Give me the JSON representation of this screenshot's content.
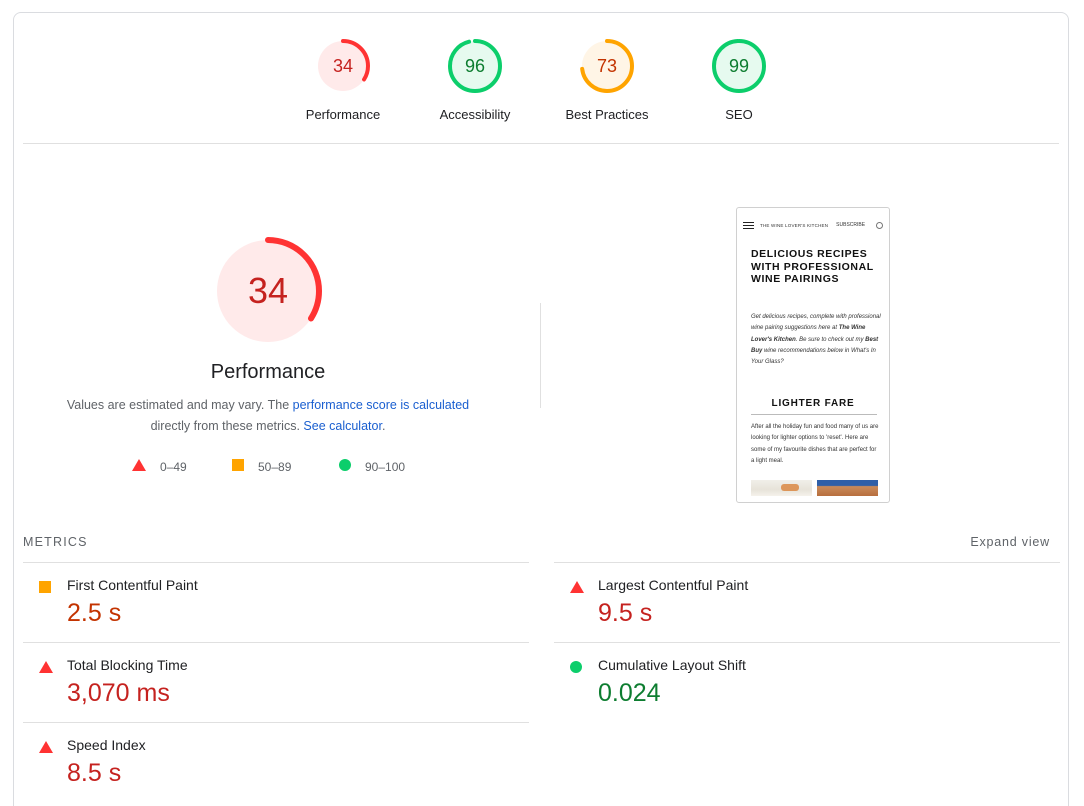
{
  "categories": [
    {
      "label": "Performance",
      "score": "34",
      "value": 34,
      "status": "fail"
    },
    {
      "label": "Accessibility",
      "score": "96",
      "value": 96,
      "status": "pass"
    },
    {
      "label": "Best Practices",
      "score": "73",
      "value": 73,
      "status": "average"
    },
    {
      "label": "SEO",
      "score": "99",
      "value": 99,
      "status": "pass"
    }
  ],
  "performance": {
    "score": "34",
    "value": 34,
    "title": "Performance",
    "desc_pre": "Values are estimated and may vary. The ",
    "desc_link1": "performance score is calculated",
    "desc_mid": " directly from these metrics. ",
    "desc_link2": "See calculator",
    "desc_post": "."
  },
  "legend": [
    {
      "range": "0–49",
      "shape": "triangle",
      "color": "#ff3333"
    },
    {
      "range": "50–89",
      "shape": "square",
      "color": "#ffa400"
    },
    {
      "range": "90–100",
      "shape": "circle",
      "color": "#0cce6b"
    }
  ],
  "screenshot": {
    "brand": "THE WINE LOVER'S  KITCHEN",
    "subscribe": "SUBSCRIBE",
    "heading": "DELICIOUS RECIPES WITH PROFESSIONAL WINE PAIRINGS",
    "intro_a": "Get delicious recipes, complete with professional wine pairing suggestions here at ",
    "intro_b": "The Wine Lover's Kitchen",
    "intro_c": ". Be sure to check out my ",
    "intro_d": "Best Buy",
    "intro_e": " wine recommendations below in What's In Your Glass?",
    "section": "LIGHTER FARE",
    "section_text": "After all the holiday fun and food many of us are looking for lighter options to 'reset'. Here are some of my favourite dishes that are perfect for a light meal."
  },
  "metrics_title": "METRICS",
  "expand_label": "Expand view",
  "metrics": [
    {
      "name": "First Contentful Paint",
      "value": "2.5 s",
      "status": "average"
    },
    {
      "name": "Largest Contentful Paint",
      "value": "9.5 s",
      "status": "fail"
    },
    {
      "name": "Total Blocking Time",
      "value": "3,070 ms",
      "status": "fail"
    },
    {
      "name": "Cumulative Layout Shift",
      "value": "0.024",
      "status": "pass"
    },
    {
      "name": "Speed Index",
      "value": "8.5 s",
      "status": "fail"
    }
  ],
  "colors": {
    "fail": "#ff3333",
    "fail_bg": "#ffeaea",
    "fail_text": "#c5221f",
    "average": "#ffa400",
    "average_bg": "#fff5e6",
    "average_text": "#c33300",
    "pass": "#0cce6b",
    "pass_bg": "#e6faef",
    "pass_text": "#0d7d30"
  }
}
